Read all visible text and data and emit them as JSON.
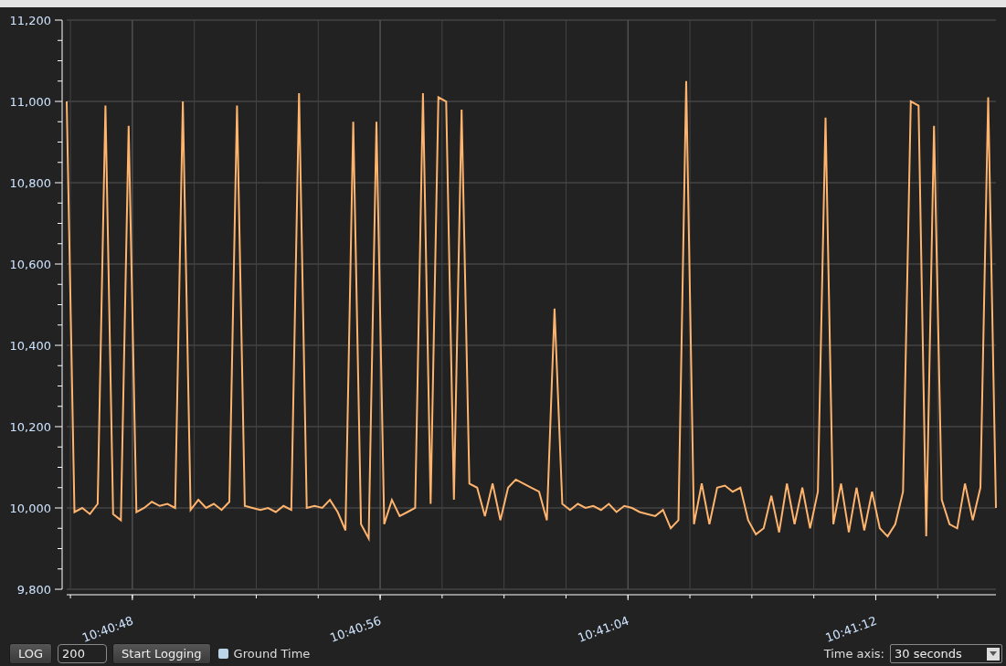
{
  "chart": {
    "chart_data": {
      "type": "line",
      "grid": true,
      "xlim": [
        38445.88,
        38475.88
      ],
      "ylim": [
        9800,
        11200
      ],
      "xticks": [
        {
          "value": 38448,
          "label": "10:40:48"
        },
        {
          "value": 38456,
          "label": "10:40:56"
        },
        {
          "value": 38464,
          "label": "10:41:04"
        },
        {
          "value": 38472,
          "label": "10:41:12"
        }
      ],
      "yticks": [
        {
          "value": 9800,
          "label": "9,800"
        },
        {
          "value": 10000,
          "label": "10,000"
        },
        {
          "value": 10200,
          "label": "10,200"
        },
        {
          "value": 10400,
          "label": "10,400"
        },
        {
          "value": 10600,
          "label": "10,600"
        },
        {
          "value": 10800,
          "label": "10,800"
        },
        {
          "value": 11000,
          "label": "11,000"
        },
        {
          "value": 11200,
          "label": "11,200"
        }
      ],
      "x": [
        38445.88,
        38446.13,
        38446.38,
        38446.63,
        38446.88,
        38447.13,
        38447.38,
        38447.63,
        38447.88,
        38448.13,
        38448.38,
        38448.63,
        38448.88,
        38449.13,
        38449.38,
        38449.63,
        38449.88,
        38450.13,
        38450.38,
        38450.63,
        38450.88,
        38451.13,
        38451.38,
        38451.63,
        38451.88,
        38452.13,
        38452.38,
        38452.63,
        38452.88,
        38453.13,
        38453.38,
        38453.63,
        38453.88,
        38454.13,
        38454.38,
        38454.63,
        38454.88,
        38455.13,
        38455.38,
        38455.63,
        38455.88,
        38456.13,
        38456.38,
        38456.63,
        38456.88,
        38457.13,
        38457.38,
        38457.63,
        38457.88,
        38458.13,
        38458.38,
        38458.63,
        38458.88,
        38459.13,
        38459.38,
        38459.63,
        38459.88,
        38460.13,
        38460.38,
        38460.63,
        38460.88,
        38461.13,
        38461.38,
        38461.63,
        38461.88,
        38462.13,
        38462.38,
        38462.63,
        38462.88,
        38463.13,
        38463.38,
        38463.63,
        38463.88,
        38464.13,
        38464.38,
        38464.63,
        38464.88,
        38465.13,
        38465.38,
        38465.63,
        38465.88,
        38466.13,
        38466.38,
        38466.63,
        38466.88,
        38467.13,
        38467.38,
        38467.63,
        38467.88,
        38468.13,
        38468.38,
        38468.63,
        38468.88,
        38469.13,
        38469.38,
        38469.63,
        38469.88,
        38470.13,
        38470.38,
        38470.63,
        38470.88,
        38471.13,
        38471.38,
        38471.63,
        38471.88,
        38472.13,
        38472.38,
        38472.63,
        38472.88,
        38473.13,
        38473.38,
        38473.63,
        38473.88,
        38474.13,
        38474.38,
        38474.63,
        38474.88,
        38475.13,
        38475.38,
        38475.63,
        38475.88
      ],
      "series": [
        {
          "color": "#ffb46e",
          "values": [
            11000,
            9990,
            10000,
            9985,
            10010,
            10990,
            9985,
            9970,
            10940,
            9990,
            10000,
            10015,
            10005,
            10010,
            10000,
            11000,
            9995,
            10020,
            10000,
            10010,
            9995,
            10015,
            10990,
            10005,
            10000,
            9995,
            10000,
            9990,
            10005,
            9995,
            11020,
            10000,
            10005,
            10000,
            10020,
            9990,
            9945,
            10950,
            9960,
            9925,
            10950,
            9960,
            10020,
            9980,
            9990,
            10000,
            11020,
            10010,
            11010,
            11000,
            10020,
            10980,
            10060,
            10050,
            9980,
            10060,
            9970,
            10050,
            10070,
            10060,
            10050,
            10040,
            9970,
            10490,
            10010,
            9995,
            10010,
            10000,
            10005,
            9995,
            10010,
            9990,
            10005,
            10000,
            9990,
            9985,
            9980,
            9995,
            9950,
            9970,
            11050,
            9960,
            10060,
            9960,
            10050,
            10055,
            10040,
            10050,
            9970,
            9935,
            9950,
            10030,
            9940,
            10060,
            9960,
            10050,
            9950,
            10040,
            10960,
            9960,
            10060,
            9940,
            10050,
            9945,
            10040,
            9950,
            9930,
            9960,
            10040,
            11000,
            10990,
            9930,
            10940,
            10020,
            9960,
            9950,
            10060,
            9970,
            10050,
            11010,
            10000
          ]
        }
      ]
    }
  },
  "controls": {
    "log_button": "LOG",
    "count_field": "200",
    "start_button": "Start Logging",
    "ground_time": {
      "label": "Ground Time",
      "checked": false
    },
    "time_axis": {
      "label": "Time axis:",
      "value": "30 seconds"
    }
  }
}
